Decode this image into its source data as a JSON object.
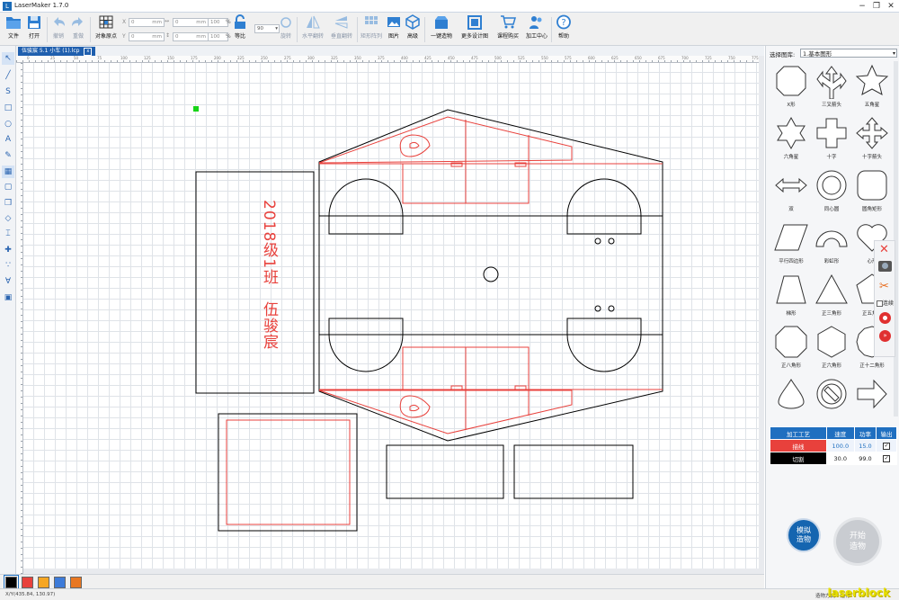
{
  "window": {
    "title": "LaserMaker 1.7.0",
    "app_icon": "L"
  },
  "toolbar": {
    "file": "文件",
    "open": "打开",
    "undo": "撤销",
    "redo": "重做",
    "origin": "对象原点",
    "x_value": "0",
    "y_value": "0",
    "w_value": "0",
    "h_value": "0",
    "unit": "mm",
    "w_percent": "100",
    "h_percent": "100",
    "percent_unit": "%",
    "ratio": "等比",
    "rotate_value": "90",
    "rotate": "旋转",
    "hflip": "水平翻转",
    "vflip": "垂直翻转",
    "array": "矩形阵列",
    "picture": "图片",
    "advanced": "高级",
    "build": "一键造物",
    "more_designs": "更多设计图",
    "buy": "课程购买",
    "center": "加工中心",
    "help": "帮助"
  },
  "document": {
    "tab_label": "伍骏宸 5.1 小车 (1).lcp",
    "tab_close": "x"
  },
  "ruler": {
    "top_labels": [
      "0",
      "25",
      "50",
      "75",
      "100",
      "125",
      "150",
      "175",
      "200",
      "225",
      "250",
      "275",
      "300",
      "325",
      "350",
      "375",
      "400",
      "425",
      "450",
      "475",
      "500",
      "525",
      "550",
      "575",
      "600",
      "625",
      "650",
      "675",
      "700",
      "725",
      "750",
      "775"
    ]
  },
  "artwork": {
    "engrave_text": "2018级1班　伍骏宸"
  },
  "right_panel": {
    "library_label": "选择图库:",
    "library_value": "1.基本图形",
    "shapes": [
      "X形",
      "三叉箭头",
      "五角星",
      "六角星",
      "十字",
      "十字箭头",
      "双",
      "同心圆",
      "圆角矩形",
      "平行四边形",
      "彩虹形",
      "心形",
      "梯形",
      "正三角形",
      "正五角形",
      "正八角形",
      "正六角形",
      "正十二角形",
      "",
      "",
      ""
    ],
    "process_headers": [
      "加工工艺",
      "速度",
      "功率",
      "输出"
    ],
    "process_rows": [
      {
        "name": "描线",
        "speed": "100.0",
        "power": "15.0",
        "color": "#e8413c"
      },
      {
        "name": "切割",
        "speed": "30.0",
        "power": "99.0",
        "color": "#000000"
      }
    ],
    "simulate": "模拟造物",
    "start": "开始造物",
    "simulate_line1": "模拟",
    "simulate_line2": "造物",
    "start_line1": "开始",
    "start_line2": "造物",
    "float_checkbox_label": "连续"
  },
  "colors": {
    "accent": "#1f6fc0",
    "engrave_red": "#e8413c",
    "swatches": [
      "#000000",
      "#e8413c",
      "#f5a623",
      "#3d7bd9",
      "#e87722"
    ]
  },
  "status": {
    "coords": "X/Y(435.84, 130.97)",
    "right": "造物方式　运行",
    "brand": "laserblock"
  }
}
